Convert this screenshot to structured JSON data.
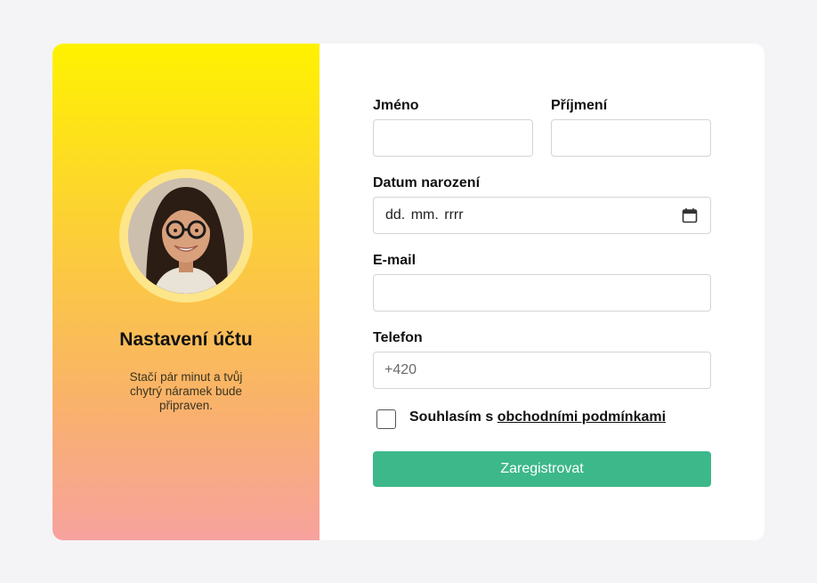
{
  "sidebar": {
    "title": "Nastavení účtu",
    "subtitle": "Stačí pár minut a tvůj chytrý náramek bude připraven."
  },
  "form": {
    "first_name": {
      "label": "Jméno",
      "value": ""
    },
    "last_name": {
      "label": "Příjmení",
      "value": ""
    },
    "birth_date": {
      "label": "Datum narození",
      "value": "dd. mm. rrrr"
    },
    "email": {
      "label": "E-mail",
      "value": ""
    },
    "phone": {
      "label": "Telefon",
      "placeholder": "+420"
    },
    "consent": {
      "prefix": "Souhlasím s ",
      "link": "obchodními podmínkami",
      "checked": false
    },
    "submit_label": "Zaregistrovat"
  },
  "colors": {
    "background": "#f4f4f6",
    "accent": "#3db88a",
    "gradient_top": "#fff200",
    "gradient_bottom": "#f7a29e"
  },
  "icons": {
    "date_picker": "calendar-icon"
  }
}
